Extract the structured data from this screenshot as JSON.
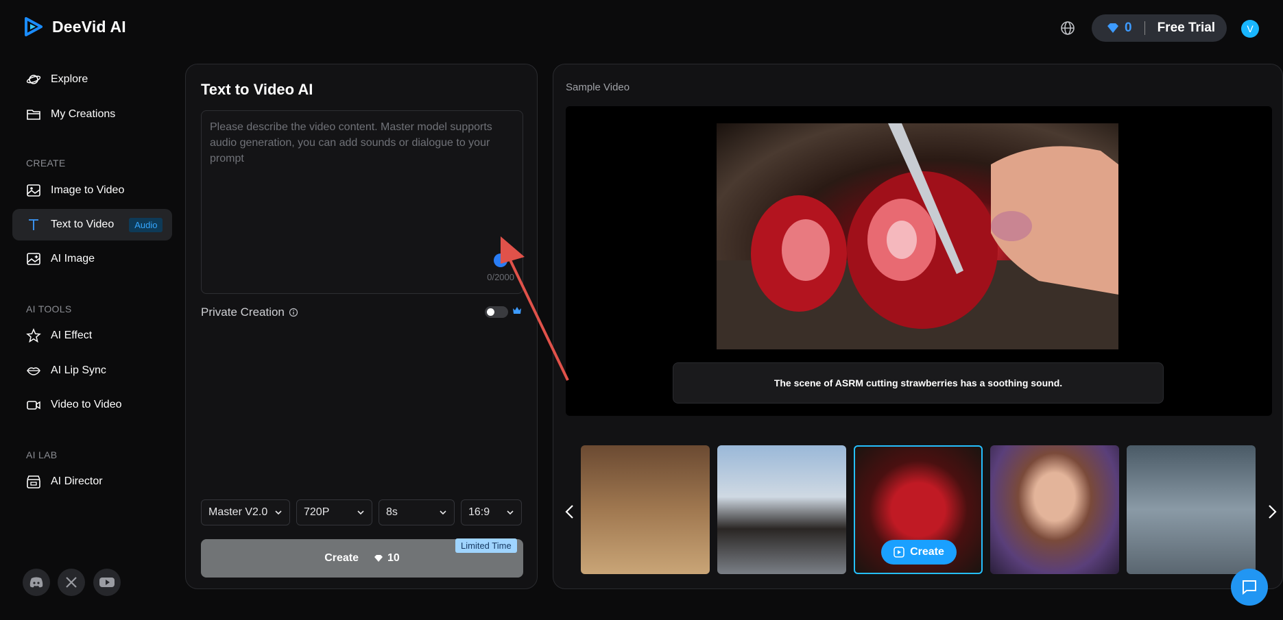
{
  "app": {
    "name": "DeeVid AI"
  },
  "header": {
    "credits": "0",
    "trial_label": "Free Trial",
    "avatar_letter": "V"
  },
  "sidebar": {
    "items": [
      {
        "label": "Explore"
      },
      {
        "label": "My Creations"
      }
    ],
    "create_title": "CREATE",
    "create_items": [
      {
        "label": "Image to Video"
      },
      {
        "label": "Text to Video",
        "badge": "Audio"
      },
      {
        "label": "AI Image"
      }
    ],
    "tools_title": "AI TOOLS",
    "tools_items": [
      {
        "label": "AI Effect"
      },
      {
        "label": "AI Lip Sync"
      },
      {
        "label": "Video to Video"
      }
    ],
    "lab_title": "AI LAB",
    "lab_items": [
      {
        "label": "AI Director"
      }
    ]
  },
  "editor": {
    "title": "Text to Video AI",
    "prompt_placeholder": "Please describe the video content. Master model supports audio generation, you can add sounds or dialogue to your prompt",
    "prompt_counter": "0/2000",
    "private_label": "Private Creation",
    "selects": {
      "model": "Master V2.0",
      "resolution": "720P",
      "duration": "8s",
      "ratio": "16:9"
    },
    "create_label": "Create",
    "create_cost": "10",
    "limited_badge": "Limited Time"
  },
  "preview": {
    "label": "Sample Video",
    "caption": "The scene of ASRM cutting strawberries has a soothing sound.",
    "thumb_create_label": "Create"
  },
  "colors": {
    "accent": "#1aa0ff",
    "credits": "#3d9bff"
  }
}
